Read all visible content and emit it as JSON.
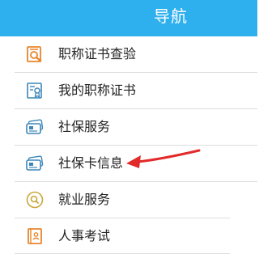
{
  "header": {
    "title": "导航"
  },
  "menu": {
    "items": [
      {
        "label": "职称证书查验",
        "icon": "certificate-search-icon"
      },
      {
        "label": "我的职称证书",
        "icon": "certificate-badge-icon"
      },
      {
        "label": "社保服务",
        "icon": "card-icon"
      },
      {
        "label": "社保卡信息",
        "icon": "card-icon"
      },
      {
        "label": "就业服务",
        "icon": "search-circle-icon"
      },
      {
        "label": "人事考试",
        "icon": "notebook-icon"
      }
    ]
  },
  "colors": {
    "header_bg": "#2fb0ee",
    "icon_orange": "#e8852b",
    "icon_blue": "#3d86b8",
    "icon_gold": "#c9a63a",
    "annotation_arrow": "#e22a2a"
  }
}
